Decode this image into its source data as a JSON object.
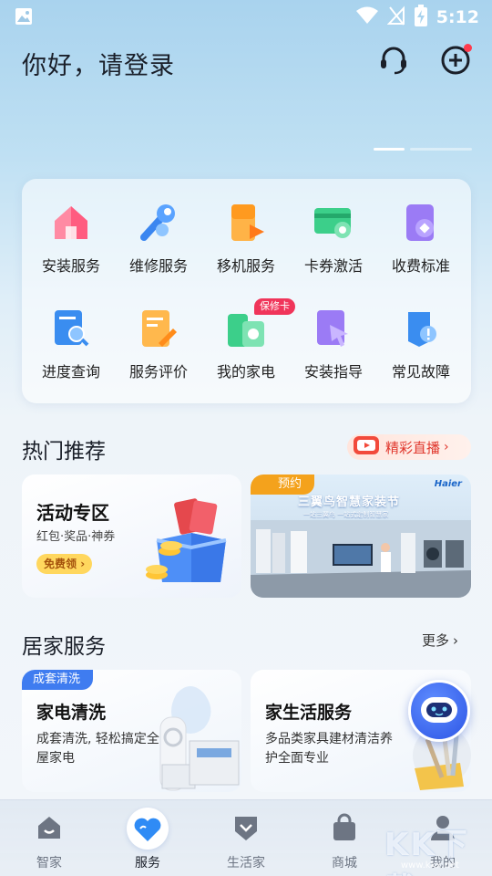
{
  "status_bar": {
    "time": "5:12"
  },
  "header": {
    "greeting": "你好，请登录"
  },
  "services": [
    {
      "label": "安装服务",
      "icon": "install-house-icon"
    },
    {
      "label": "维修服务",
      "icon": "repair-wrench-icon"
    },
    {
      "label": "移机服务",
      "icon": "relocate-fridge-icon"
    },
    {
      "label": "卡券激活",
      "icon": "coupon-card-icon"
    },
    {
      "label": "收费标准",
      "icon": "fee-standard-icon"
    },
    {
      "label": "进度查询",
      "icon": "progress-search-icon"
    },
    {
      "label": "服务评价",
      "icon": "review-pen-icon"
    },
    {
      "label": "我的家电",
      "icon": "my-appliance-icon"
    },
    {
      "label": "安装指导",
      "icon": "install-guide-icon"
    },
    {
      "label": "常见故障",
      "icon": "fault-faq-icon"
    }
  ],
  "service_tag": "保修卡",
  "hot": {
    "title": "热门推荐",
    "live_label": "精彩直播",
    "activity": {
      "title": "活动专区",
      "subtitle": "红包·奖品·神券",
      "button": "免费领"
    },
    "promo": {
      "tag": "预约",
      "brand": "Haier",
      "headline": "三翼鸟智慧家装节",
      "sub": "一站三翼鸟 一站式定制智慧家"
    }
  },
  "home_service": {
    "title": "居家服务",
    "more": "更多",
    "cards": [
      {
        "tag": "成套清洗",
        "title": "家电清洗",
        "desc": "成套清洗, 轻松搞定全屋家电"
      },
      {
        "title": "家生活服务",
        "desc": "多品类家具建材清洁养护全面专业"
      }
    ]
  },
  "nav": [
    {
      "label": "智家",
      "icon": "smart-home-icon"
    },
    {
      "label": "服务",
      "icon": "service-heart-icon",
      "active": true
    },
    {
      "label": "生活家",
      "icon": "life-shield-icon"
    },
    {
      "label": "商城",
      "icon": "mall-bag-icon"
    },
    {
      "label": "我的",
      "icon": "profile-person-icon"
    }
  ],
  "watermark": {
    "text": "KK下载",
    "url": "www.kkx.net"
  }
}
